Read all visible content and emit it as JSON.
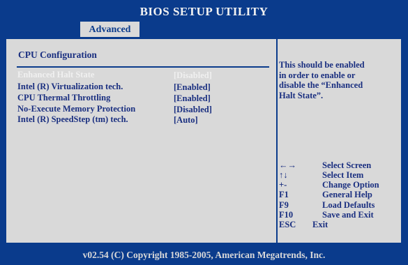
{
  "header": {
    "title": "BIOS SETUP UTILITY"
  },
  "tabs": [
    {
      "label": "Advanced"
    }
  ],
  "main": {
    "section_title": "CPU Configuration",
    "options": [
      {
        "label": "Enhanced Halt State",
        "value": "[Disabled]",
        "selected": true
      },
      {
        "label": "Intel (R) Virtualization tech.",
        "value": "[Enabled]",
        "selected": false
      },
      {
        "label": "CPU Thermal Throttling",
        "value": "[Enabled]",
        "selected": false
      },
      {
        "label": "No-Execute Memory Protection",
        "value": "[Disabled]",
        "selected": false
      },
      {
        "label": "Intel (R) SpeedStep (tm)  tech.",
        "value": "[Auto]",
        "selected": false
      }
    ]
  },
  "help": {
    "lines": [
      "This should be enabled",
      "in order to enable or",
      "disable the “Enhanced",
      "Halt State”."
    ],
    "keys": [
      {
        "key": "←→",
        "desc": "Select Screen"
      },
      {
        "key": "↑↓",
        "desc": "Select Item"
      },
      {
        "key": "+-",
        "desc": "Change Option"
      },
      {
        "key": "F1",
        "desc": "General Help"
      },
      {
        "key": "F9",
        "desc": "Load Defaults"
      },
      {
        "key": "F10",
        "desc": "Save and Exit"
      },
      {
        "key": "ESC",
        "desc": "Exit"
      }
    ]
  },
  "footer": {
    "text": "v02.54 (C) Copyright 1985-2005, American Megatrends, Inc."
  },
  "colors": {
    "bios_blue": "#0a3b8c",
    "panel_gray": "#d9d9d9",
    "highlight_text": "#f0f0f0"
  }
}
